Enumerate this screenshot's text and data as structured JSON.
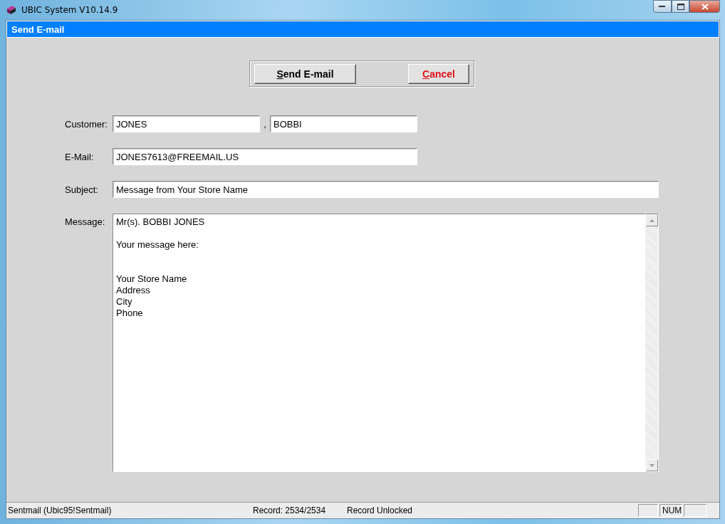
{
  "window": {
    "title": "UBIC System V10.14.9"
  },
  "form_title": "Send E-mail",
  "buttons": [
    {
      "label": "Send E-mail",
      "kind": "primary"
    },
    {
      "label": "Cancel",
      "kind": "cancel"
    }
  ],
  "customer": {
    "label": "Customer:",
    "last_name": "JONES",
    "separator": ",",
    "first_name": "BOBBI"
  },
  "email": {
    "label": "E-Mail:",
    "value": "JONES7613@FREEMAIL.US"
  },
  "subject": {
    "label": "Subject:",
    "value": "Message from Your Store Name"
  },
  "message": {
    "label": "Message:",
    "value": "Mr(s). BOBBI JONES\n\nYour message here:\n\n\nYour Store Name\nAddress\nCity\nPhone"
  },
  "status_bar": {
    "source": "Sentmail (Ubic95!Sentmail)",
    "record": "Record: 2534/2534",
    "lock": "Record Unlocked",
    "indicator": "NUM"
  }
}
